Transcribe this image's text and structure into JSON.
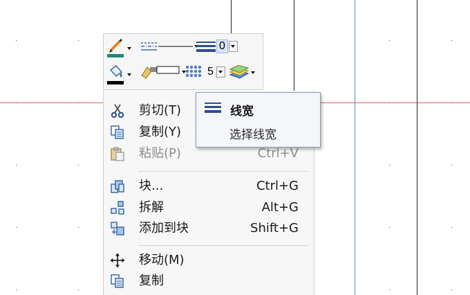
{
  "toolbar": {
    "lineweight_value": "0",
    "grid_value": "5"
  },
  "context_menu": {
    "items": [
      {
        "label": "剪切(T)",
        "shortcut": "",
        "icon": "scissors-icon",
        "enabled": true
      },
      {
        "label": "复制(Y)",
        "shortcut": "",
        "icon": "copy-icon",
        "enabled": true
      },
      {
        "label": "粘贴(P)",
        "shortcut": "Ctrl+V",
        "icon": "paste-icon",
        "enabled": false
      },
      {
        "label": "块...",
        "shortcut": "Ctrl+G",
        "icon": "block-icon",
        "enabled": true
      },
      {
        "label": "拆解",
        "shortcut": "Alt+G",
        "icon": "explode-icon",
        "enabled": true
      },
      {
        "label": "添加到块",
        "shortcut": "Shift+G",
        "icon": "add-to-block-icon",
        "enabled": true
      },
      {
        "label": "移动(M)",
        "shortcut": "",
        "icon": "move-icon",
        "enabled": true
      },
      {
        "label": "复制",
        "shortcut": "",
        "icon": "copy-icon",
        "enabled": true
      }
    ]
  },
  "tooltip": {
    "title": "线宽",
    "description": "选择线宽",
    "icon": "lineweight-icon"
  },
  "colors": {
    "red_axis": "#e06666",
    "blue_line": "#4a90c2",
    "stroke_color": "#1f8a7a",
    "fill_color": "#000000"
  }
}
